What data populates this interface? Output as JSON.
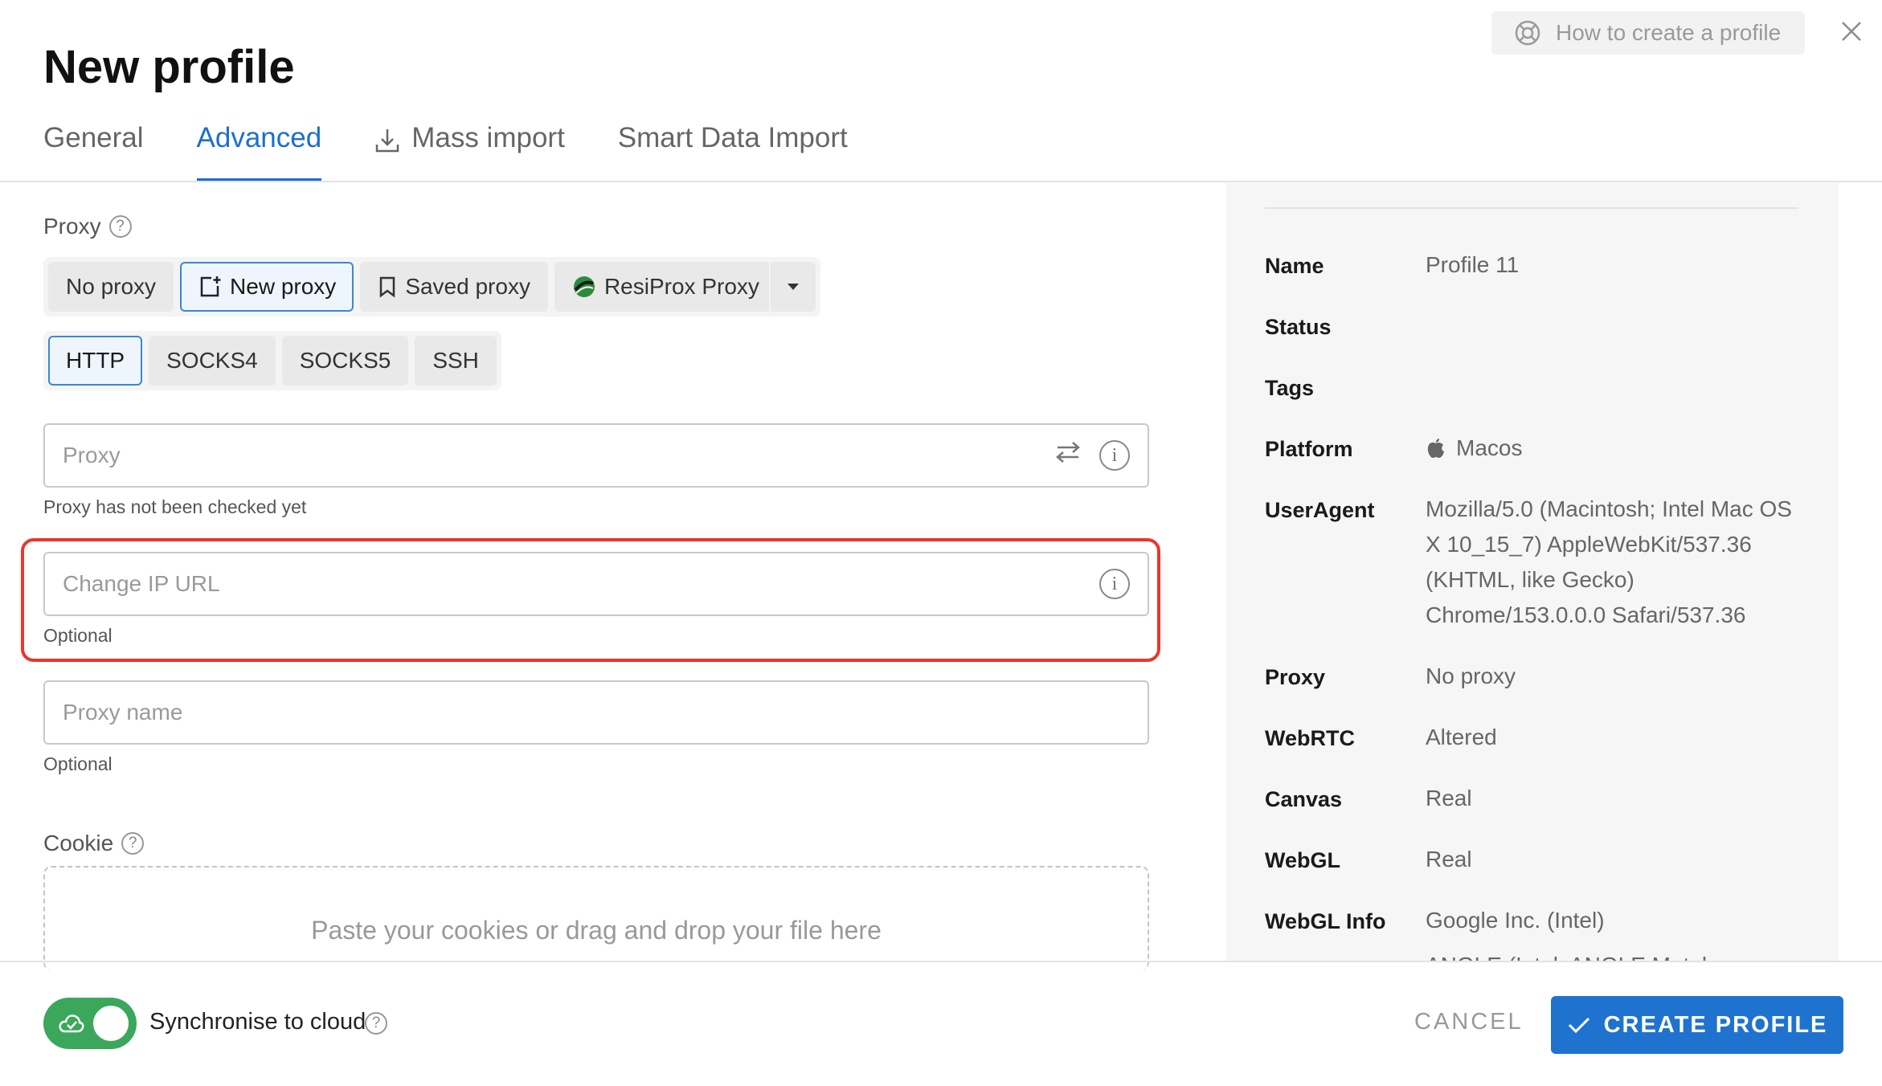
{
  "header": {
    "title": "New profile",
    "help_label": "How to create a profile"
  },
  "tabs": [
    {
      "label": "General"
    },
    {
      "label": "Advanced"
    },
    {
      "label": "Mass import"
    },
    {
      "label": "Smart Data Import"
    }
  ],
  "proxy": {
    "section_label": "Proxy",
    "modes": [
      {
        "label": "No proxy"
      },
      {
        "label": "New proxy"
      },
      {
        "label": "Saved proxy"
      },
      {
        "label": "ResiProx Proxy"
      }
    ],
    "active_mode": "New proxy",
    "types": [
      {
        "label": "HTTP"
      },
      {
        "label": "SOCKS4"
      },
      {
        "label": "SOCKS5"
      },
      {
        "label": "SSH"
      }
    ],
    "active_type": "HTTP",
    "proxy_field": {
      "placeholder": "Proxy",
      "hint": "Proxy has not been checked yet"
    },
    "change_ip_field": {
      "placeholder": "Change IP URL",
      "hint": "Optional"
    },
    "proxy_name_field": {
      "placeholder": "Proxy name",
      "hint": "Optional"
    }
  },
  "cookie": {
    "section_label": "Cookie",
    "placeholder": "Paste your cookies or drag and drop your file here"
  },
  "summary": {
    "rows": [
      {
        "key": "Name",
        "value": "Profile 11"
      },
      {
        "key": "Status",
        "value": ""
      },
      {
        "key": "Tags",
        "value": ""
      },
      {
        "key": "Platform",
        "value": "Macos"
      },
      {
        "key": "UserAgent",
        "value": "Mozilla/5.0 (Macintosh; Intel Mac OS X 10_15_7) AppleWebKit/537.36 (KHTML, like Gecko) Chrome/153.0.0.0 Safari/537.36"
      },
      {
        "key": "Proxy",
        "value": "No proxy"
      },
      {
        "key": "WebRTC",
        "value": "Altered"
      },
      {
        "key": "Canvas",
        "value": "Real"
      },
      {
        "key": "WebGL",
        "value": "Real"
      },
      {
        "key": "WebGL Info",
        "value": "Google Inc. (Intel)"
      }
    ],
    "webgl_info_clipped": "ANGLE (Intel, ANGLE Metal"
  },
  "footer": {
    "sync_label": "Synchronise to cloud",
    "sync_enabled": true,
    "cancel_label": "CANCEL",
    "create_label": "CREATE PROFILE"
  },
  "colors": {
    "accent": "#1f73cf",
    "toggle_on": "#3ba75a",
    "highlight": "#e8372e"
  }
}
